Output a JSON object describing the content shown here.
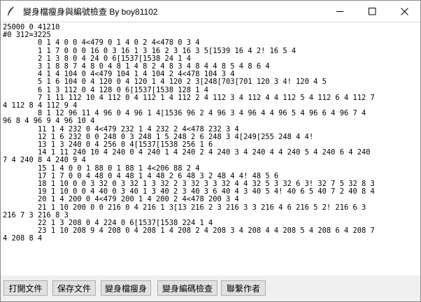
{
  "window": {
    "title": "變身檔瘦身與編號檢查 By boy81102",
    "icon": "feather-icon"
  },
  "controls": {
    "minimize": "minimize-icon",
    "maximize": "maximize-icon",
    "close": "close-icon"
  },
  "editor": {
    "lines": [
      "25000 0 41210",
      "#0 312=3225",
      "        0 1 4 0 0 4<479 0 1 4 0 2 4<478 0 3 4",
      "        1 1 7 0 0 0 16 0 3 16 1 3 16 2 3 16 3 5[1539 16 4 2! 16 5 4",
      "        2 1 3 8 0 4 24 0 6[1537[1538 24 1 4",
      "        3 1 8 8 7 4 8 0 4 8 1 4 8 2 4 8 3 4 8 4 4 8 5 4 8 6 4",
      "        4 1 4 104 0 4<479 104 1 4 104 2 4<478 104 3 4",
      "        5 1 6 104 0 4 120 0 4 120 1 4 120 2 3[248[703[701 120 3 4! 120 4 5",
      "        6 1 3 112 0 4 128 0 6[1537[1538 128 1 4",
      "        7 1 11 112 10 4 112 0 4 112 1 4 112 2 4 112 3 4 112 4 4 112 5 4 112 6 4 112 7",
      "4 112 8 4 112 9 4",
      "        8 1 12 96 11 4 96 0 4 96 1 4[1536 96 2 4 96 3 4 96 4 4 96 5 4 96 6 4 96 7 4",
      "96 8 4 96 9 4 96 10 4",
      "        11 1 4 232 0 4<479 232 1 4 232 2 4<478 232 3 4",
      "        12 1 6 232 0 0 248 0 3 248 1 5 248 2 6 248 3 4[249[255 248 4 4!",
      "        13 1 3 240 0 4 256 0 4[1537[1538 256 1 6",
      "        14 1 11 240 10 4 240 0 4 240 1 4 240 2 4 240 3 4 240 4 4 240 5 4 240 6 4 240",
      "7 4 240 8 4 240 9 4",
      "        15 1 4 0 0 1 88 0 1 88 1 4<206 88 2 4",
      "        17 1 7 0 0 4 48 0 4 48 1 4 48 2 6 48 3 2 48 4 4! 48 5 6",
      "        18 1 10 0 0 3 32 0 3 32 1 3 32 2 3 32 3 3 32 4 4 32 5 3 32 6 3! 32 7 5 32 8 3",
      "        19 1 10 0 0 4 40 0 3 40 1 3 40 2 3 40 3 6 40 4 3 40 5 4! 40 6 5 40 7 2 40 8 4",
      "        20 1 4 200 0 4<479 200 1 4 200 2 4<478 200 3 4",
      "        21 1 10 200 0 0 216 0 4 216 1 3[13 216 2 3 216 3 3 216 4 6 216 5 2! 216 6 3",
      "216 7 3 216 8 3",
      "        22 1 3 208 0 4 224 0 6[1537[1538 224 1 4",
      "        23 1 10 208 9 4 208 0 4 208 1 4 208 2 4 208 3 4 208 4 4 208 5 4 208 6 4 208 7",
      "4 208 8 4"
    ]
  },
  "buttons": {
    "open": "打開文件",
    "save": "保存文件",
    "slim": "變身檔瘦身",
    "check": "變身編碼檢查",
    "contact": "聯繫作者"
  }
}
